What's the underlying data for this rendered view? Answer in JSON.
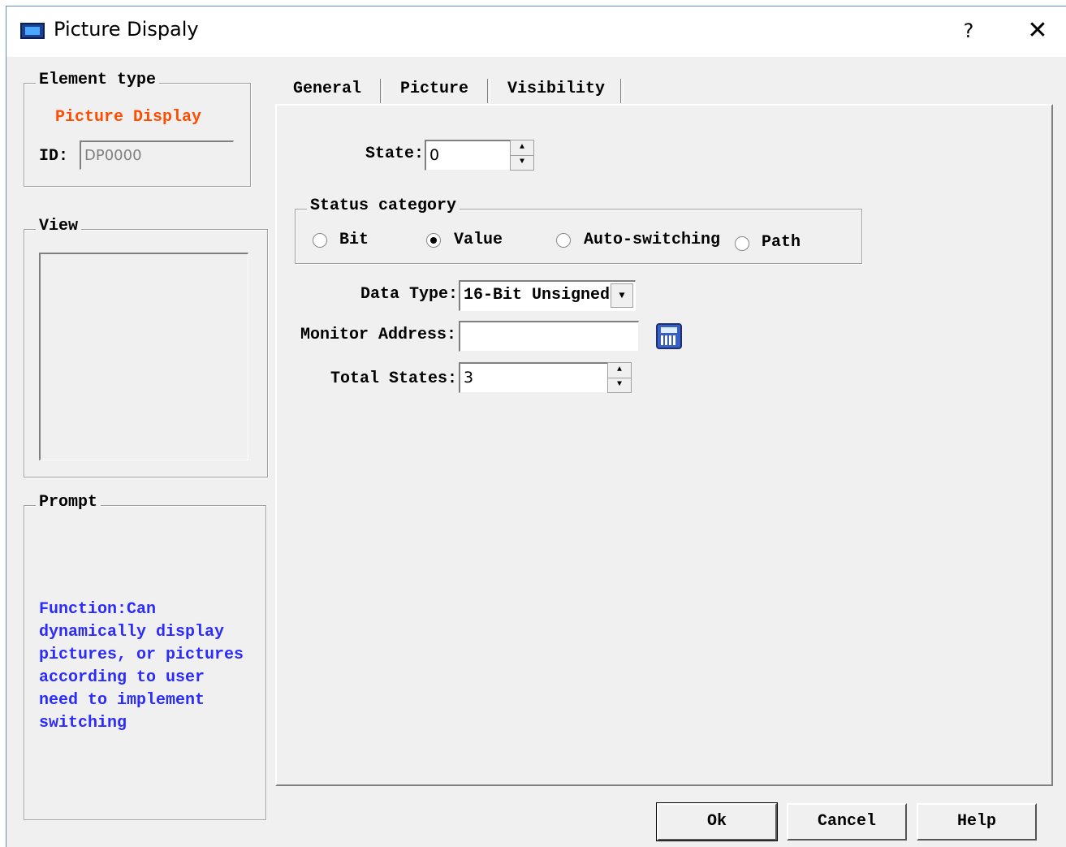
{
  "window": {
    "title": "Picture Dispaly",
    "help_glyph": "?",
    "close_glyph": "✕",
    "app_icon": "hmi-icon"
  },
  "element_type": {
    "group_label": "Element type",
    "type_name": "Picture Display",
    "type_color": "#ff4d00",
    "id_label": "ID:",
    "id_value": "DP0000"
  },
  "view": {
    "group_label": "View"
  },
  "prompt": {
    "group_label": "Prompt",
    "lines": [
      "Function:Can",
      "dynamically display",
      "pictures, or pictures",
      "according to user",
      "need to implement",
      "switching"
    ],
    "text_color": "#2b2bff"
  },
  "tabs": [
    {
      "label": "General",
      "active": true
    },
    {
      "label": "Picture",
      "active": false
    },
    {
      "label": "Visibility",
      "active": false
    }
  ],
  "general": {
    "state_label": "State:",
    "state_value": "0",
    "status_category": {
      "label": "Status category",
      "options": [
        {
          "label": "Bit",
          "checked": false
        },
        {
          "label": "Value",
          "checked": true
        },
        {
          "label": "Auto-switching",
          "checked": false
        },
        {
          "label": "Path",
          "checked": false
        }
      ]
    },
    "data_type_label": "Data Type:",
    "data_type_value": "16-Bit Unsigned",
    "monitor_address_label": "Monitor Address:",
    "monitor_address_value": "",
    "total_states_label": "Total States:",
    "total_states_value": "3"
  },
  "buttons": {
    "ok": "Ok",
    "cancel": "Cancel",
    "help": "Help"
  }
}
